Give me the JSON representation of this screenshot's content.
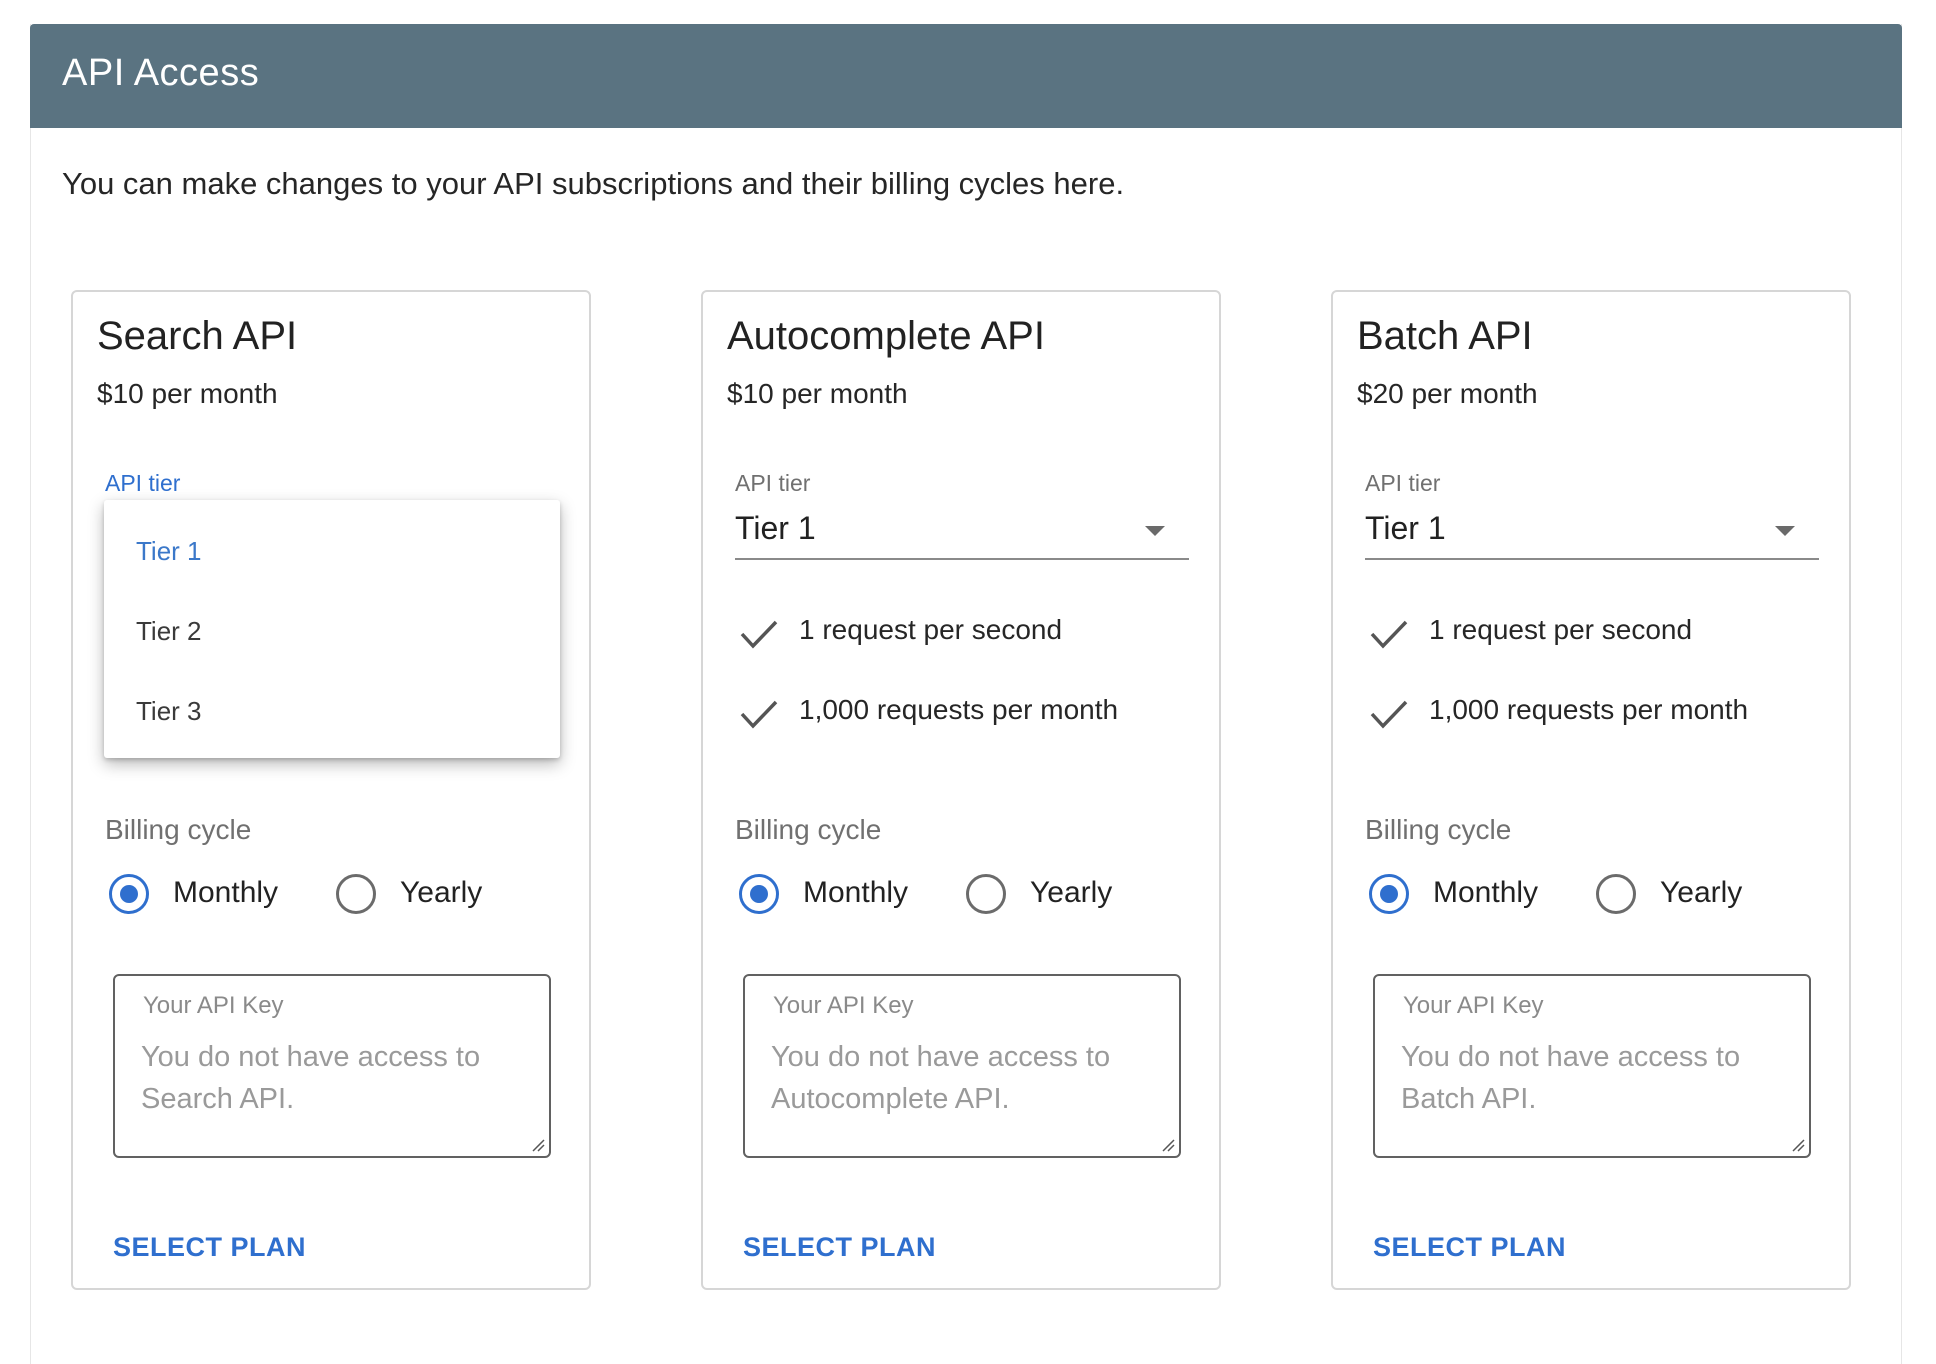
{
  "header": {
    "title": "API Access"
  },
  "intro": "You can make changes to your API subscriptions and their billing cycles here.",
  "colors": {
    "header_bg": "#5a7381",
    "accent": "#2f6fce"
  },
  "cards": [
    {
      "title": "Search API",
      "price": "$10 per month",
      "tier_label": "API tier",
      "dropdown_open": true,
      "dropdown_options": [
        "Tier 1",
        "Tier 2",
        "Tier 3"
      ],
      "dropdown_selected": "Tier 1",
      "billing_label": "Billing cycle",
      "billing_options": [
        "Monthly",
        "Yearly"
      ],
      "billing_selected": "Monthly",
      "key_label": "Your API Key",
      "key_text": "You do not have access to Search API.",
      "button": "SELECT PLAN"
    },
    {
      "title": "Autocomplete API",
      "price": "$10 per month",
      "tier_label": "API tier",
      "tier_value": "Tier 1",
      "features": [
        "1 request per second",
        "1,000 requests per month"
      ],
      "billing_label": "Billing cycle",
      "billing_options": [
        "Monthly",
        "Yearly"
      ],
      "billing_selected": "Monthly",
      "key_label": "Your API Key",
      "key_text": "You do not have access to Autocomplete API.",
      "button": "SELECT PLAN"
    },
    {
      "title": "Batch API",
      "price": "$20 per month",
      "tier_label": "API tier",
      "tier_value": "Tier 1",
      "features": [
        "1 request per second",
        "1,000 requests per month"
      ],
      "billing_label": "Billing cycle",
      "billing_options": [
        "Monthly",
        "Yearly"
      ],
      "billing_selected": "Monthly",
      "key_label": "Your API Key",
      "key_text": "You do not have access to Batch API.",
      "button": "SELECT PLAN"
    }
  ]
}
